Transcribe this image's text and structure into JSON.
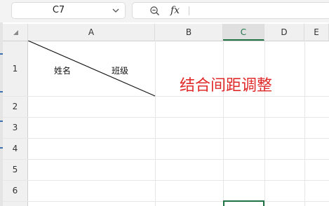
{
  "name_box": {
    "value": "C7"
  },
  "formula_bar": {
    "fx_label": "fx",
    "value": ""
  },
  "columns": [
    {
      "label": "A",
      "active": false
    },
    {
      "label": "B",
      "active": false
    },
    {
      "label": "C",
      "active": true
    },
    {
      "label": "D",
      "active": false
    },
    {
      "label": "E",
      "active": false
    }
  ],
  "rows": [
    "1",
    "2",
    "3",
    "4",
    "5",
    "6"
  ],
  "cell_a1": {
    "left_label": "姓名",
    "right_label": "班级",
    "diagonal_border": true
  },
  "annotation": {
    "text": "结合间距调整",
    "color": "#e02a2a"
  },
  "selected_cell": "C7",
  "accent_color": "#217346"
}
